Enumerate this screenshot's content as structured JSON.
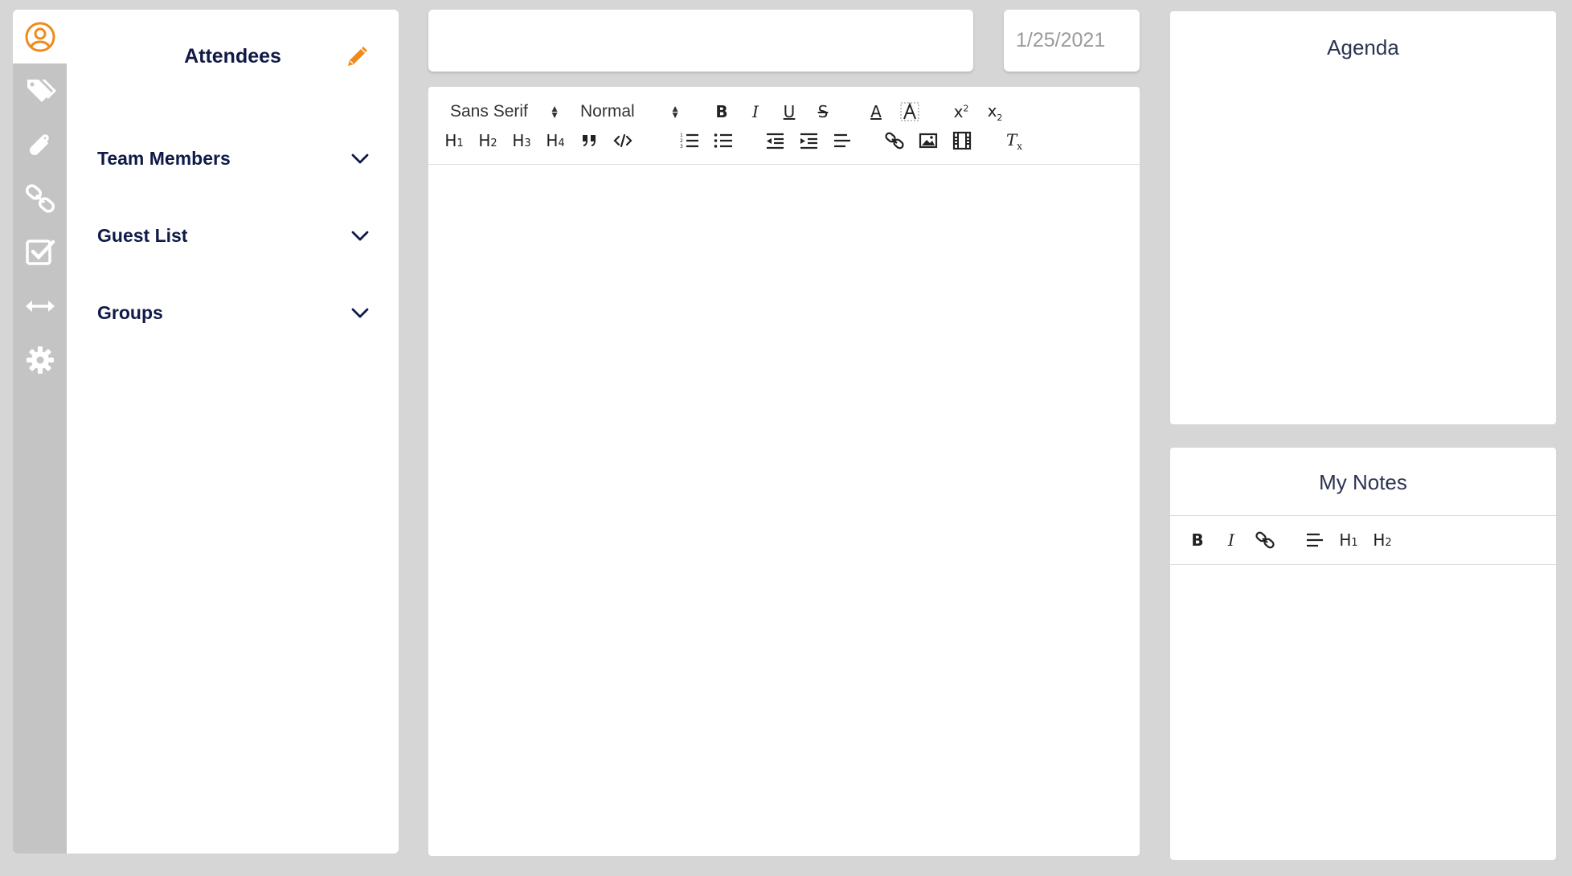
{
  "rail": {
    "items": [
      {
        "name": "attendees",
        "icon": "user-circle-icon",
        "active": true
      },
      {
        "name": "tags",
        "icon": "tags-icon"
      },
      {
        "name": "attachments",
        "icon": "paperclip-icon"
      },
      {
        "name": "links",
        "icon": "link-icon"
      },
      {
        "name": "tasks",
        "icon": "checkbox-icon"
      },
      {
        "name": "width",
        "icon": "arrows-horizontal-icon"
      },
      {
        "name": "settings",
        "icon": "gear-icon"
      }
    ]
  },
  "attendees": {
    "title": "Attendees",
    "sections": [
      {
        "label": "Team Members"
      },
      {
        "label": "Guest List"
      },
      {
        "label": "Groups"
      }
    ]
  },
  "meeting": {
    "title_value": "",
    "date_value": "1/25/2021"
  },
  "editor": {
    "font_picker": "Sans Serif",
    "size_picker": "Normal"
  },
  "agenda": {
    "title": "Agenda"
  },
  "notes": {
    "title": "My Notes"
  },
  "colors": {
    "accent": "#f08a1c",
    "navy": "#101a48",
    "rail": "#c4c4c4",
    "background": "#d6d6d6",
    "rail_icon": "#ffffff"
  }
}
